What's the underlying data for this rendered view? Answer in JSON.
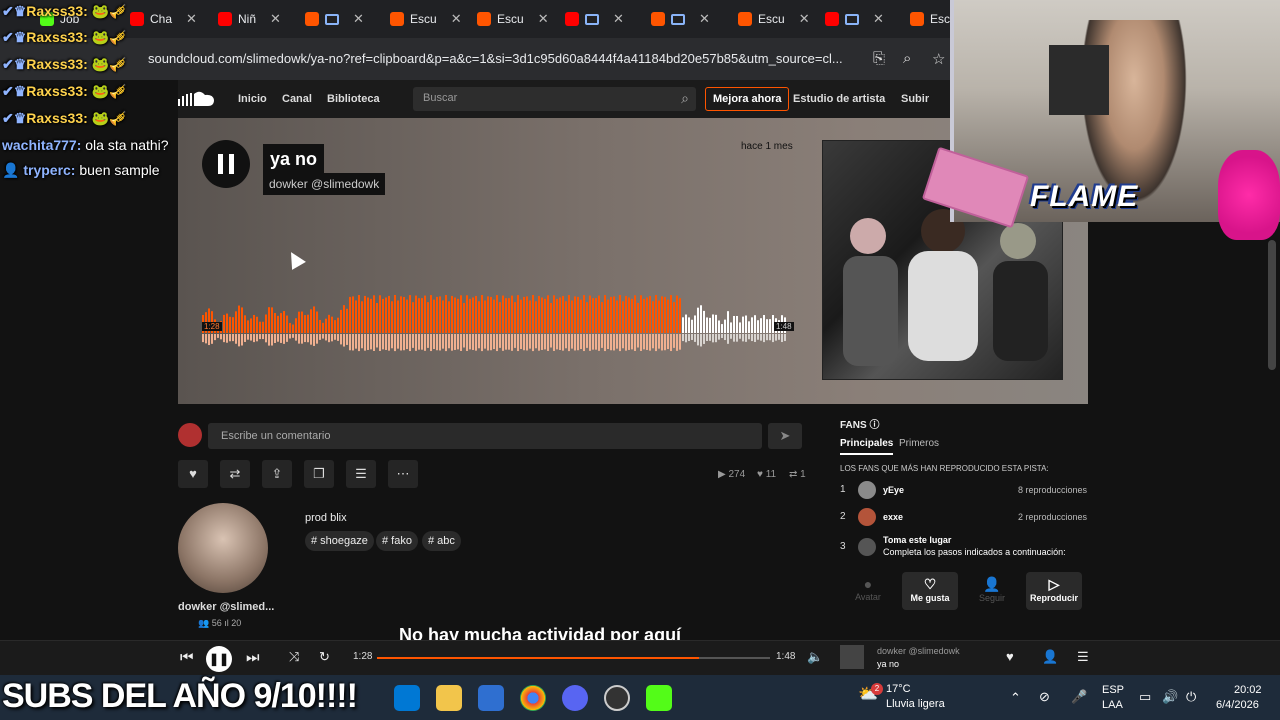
{
  "browser": {
    "tabs": [
      {
        "label": "Job",
        "icon": "kick-icon"
      },
      {
        "label": "Cha",
        "icon": "youtube-icon"
      },
      {
        "label": "Niñ",
        "icon": "youtube-icon"
      },
      {
        "label": "",
        "icon": "soundcloud-icon"
      },
      {
        "label": "Escu",
        "icon": "soundcloud-icon"
      },
      {
        "label": "Escu",
        "icon": "soundcloud-icon"
      },
      {
        "label": "",
        "icon": "youtube-icon"
      },
      {
        "label": "",
        "icon": "soundcloud-icon"
      },
      {
        "label": "Escu",
        "icon": "soundcloud-icon"
      },
      {
        "label": "",
        "icon": "youtube-icon"
      },
      {
        "label": "Esc",
        "icon": "soundcloud-icon"
      }
    ],
    "url": "soundcloud.com/slimedowk/ya-no?ref=clipboard&p=a&c=1&si=3d1c95d60a8444f4a41184bd20e57b85&utm_source=cl..."
  },
  "chat": {
    "lines": [
      {
        "user": "Raxss33:",
        "msg": ""
      },
      {
        "user": "Raxss33:",
        "msg": ""
      },
      {
        "user": "Raxss33:",
        "msg": ""
      },
      {
        "user": "Raxss33:",
        "msg": ""
      },
      {
        "user": "Raxss33:",
        "msg": ""
      },
      {
        "user": "wachita777:",
        "msg": "ola sta nathi?"
      },
      {
        "user": "tryperc:",
        "msg": "buen sample"
      }
    ]
  },
  "header": {
    "nav": [
      "Inicio",
      "Canal",
      "Biblioteca"
    ],
    "search_placeholder": "Buscar",
    "upgrade": "Mejora ahora",
    "artist_studio": "Estudio de artista",
    "upload": "Subir"
  },
  "track": {
    "title": "ya no",
    "artist": "dowker @slimedowk",
    "posted": "hace 1 mes",
    "wave_start": "1:28",
    "wave_end": "1:48"
  },
  "comment": {
    "placeholder": "Escribe un comentario"
  },
  "stats": {
    "plays": "274",
    "likes": "11",
    "reposts": "1"
  },
  "artist": {
    "name": "dowker @slimed...",
    "followers": "56",
    "tracks": "20"
  },
  "description": {
    "text": "prod blix",
    "tags": [
      "# shoegaze",
      "# fako",
      "# abc"
    ],
    "no_activity": "No hay mucha actividad por aquí"
  },
  "fans": {
    "title": "FANS",
    "tab_principales": "Principales",
    "tab_primeros": "Primeros",
    "caption": "LOS FANS QUE MÁS HAN REPRODUCIDO ESTA PISTA:",
    "rows": [
      {
        "rank": "1",
        "name": "yEye",
        "count": "8 reproducciones"
      },
      {
        "rank": "2",
        "name": "exxe",
        "count": "2 reproducciones"
      },
      {
        "rank": "3",
        "name": "Toma este lugar",
        "count": ""
      }
    ],
    "row3_sub": "Completa los pasos indicados a continuación:",
    "actions": [
      "Avatar",
      "Me gusta",
      "Seguir",
      "Reproducir"
    ]
  },
  "player": {
    "current": "1:28",
    "total": "1:48",
    "progress": 0.82,
    "artist": "dowker @slimedowk",
    "title": "ya no"
  },
  "taskbar": {
    "overlay_text": "SUBS DEL AÑO 9/10!!!!",
    "weather_temp": "17°C",
    "weather_desc": "Lluvia ligera",
    "weather_badge": "2",
    "lang": "ESP",
    "lang2": "LAA",
    "time": "20:02",
    "date": "6/4/2026"
  },
  "overlay": {
    "flame": "FLAME"
  },
  "colors": {
    "accent": "#ff5500",
    "played": "#ff5500",
    "unplayed": "#ffffff"
  }
}
